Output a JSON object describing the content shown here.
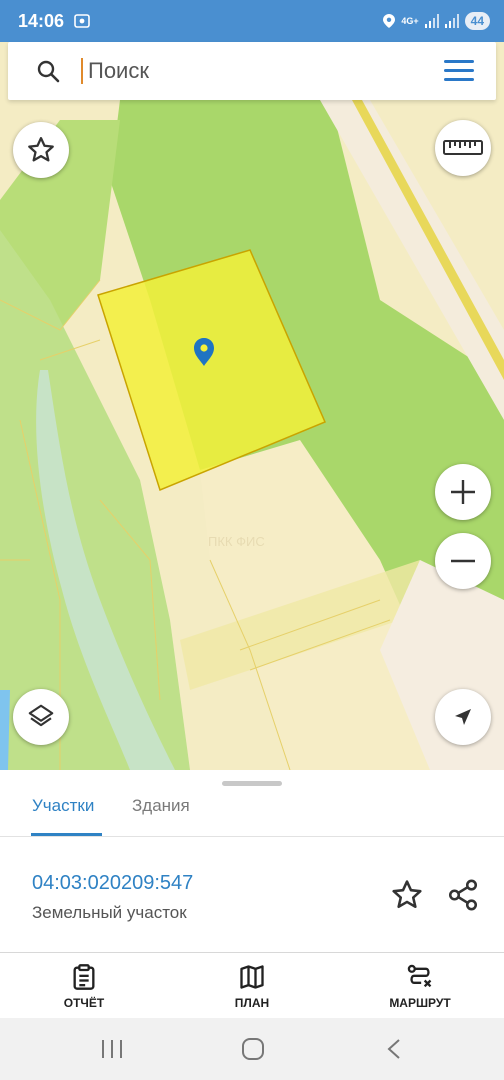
{
  "status_bar": {
    "time": "14:06",
    "network": "4G+",
    "battery": "44"
  },
  "search": {
    "placeholder": "Поиск"
  },
  "map": {
    "watermark": "ПКК ФИС",
    "parcel_fill_color": "#f2f03a",
    "marker_color": "#1f74c2",
    "buttons": [
      "star-icon",
      "ruler-icon",
      "zoom-in-icon",
      "zoom-out-icon",
      "layers-icon",
      "navigation-arrow-icon"
    ]
  },
  "sheet": {
    "tabs": [
      "Участки",
      "Здания"
    ],
    "active_tab": "Участки",
    "parcel": {
      "number": "04:03:020209:547",
      "type": "Земельный участок"
    }
  },
  "bottom_nav": {
    "items": [
      {
        "label": "ОТЧЁТ",
        "icon": "report-clipboard-icon"
      },
      {
        "label": "ПЛАН",
        "icon": "map-plan-icon"
      },
      {
        "label": "МАРШРУТ",
        "icon": "route-icon"
      }
    ]
  },
  "colors": {
    "accent": "#2f82c4",
    "status_bar": "#4a8fd0"
  }
}
